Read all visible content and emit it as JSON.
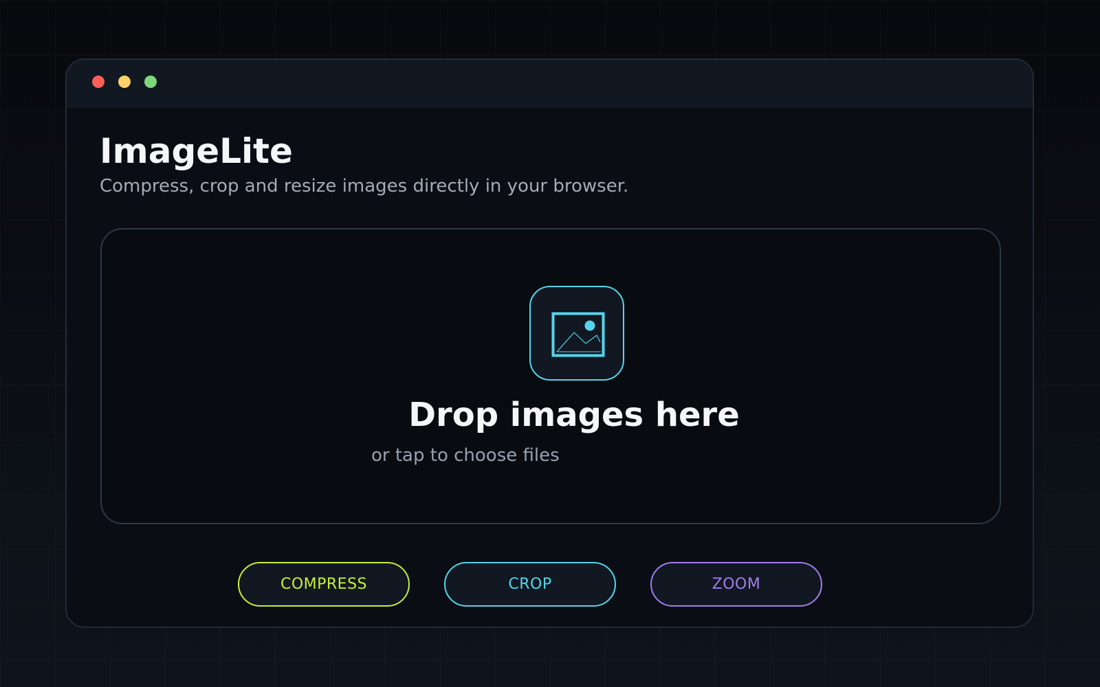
{
  "window": {
    "controls": [
      {
        "name": "close",
        "color": "#ff5f57"
      },
      {
        "name": "minimize",
        "color": "#ffd166"
      },
      {
        "name": "maximize",
        "color": "#7ed77b"
      }
    ]
  },
  "app": {
    "title": "ImageLite",
    "subtitle": "Compress, crop and resize images directly in your browser."
  },
  "dropzone": {
    "icon": "image-icon",
    "icon_color": "#56d4ec",
    "title": "Drop images here",
    "subtitle": "or tap to choose files"
  },
  "tools": [
    {
      "label": "COMPRESS",
      "color": "#c6f135"
    },
    {
      "label": "CROP",
      "color": "#56d4ec"
    },
    {
      "label": "ZOOM",
      "color": "#a47cf0"
    }
  ]
}
